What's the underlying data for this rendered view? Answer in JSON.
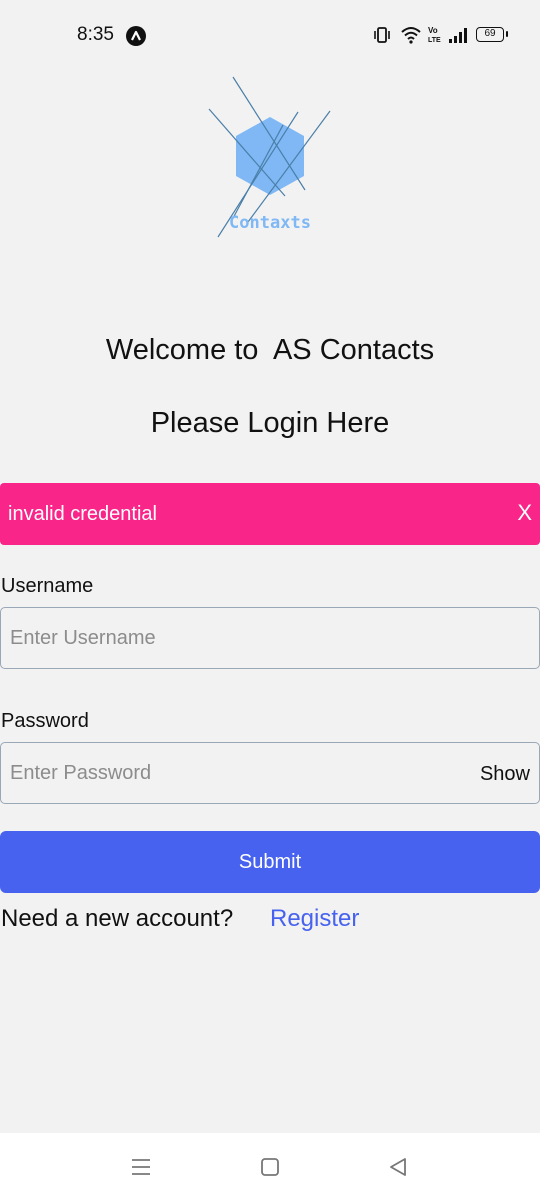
{
  "status_bar": {
    "time": "8:35",
    "battery_level": "69",
    "icons": [
      "app-notification-icon",
      "vibrate-icon",
      "wifi-icon",
      "volte-icon",
      "signal-icon",
      "battery-icon"
    ]
  },
  "logo": {
    "text": "Contaxts",
    "color": "#7fb8f4"
  },
  "welcome_text": "Welcome to  AS Contacts",
  "login_heading": "Please Login Here",
  "alert": {
    "message": "invalid credential",
    "close_label": "X",
    "color": "#f92589"
  },
  "form": {
    "username_label": "Username",
    "username_placeholder": "Enter Username",
    "username_value": "",
    "password_label": "Password",
    "password_placeholder": "Enter Password",
    "password_value": "",
    "show_label": "Show",
    "submit_label": "Submit",
    "submit_color": "#4662ef"
  },
  "register": {
    "prompt": "Need a new account?",
    "link_label": "Register"
  },
  "nav_bar": {
    "icons": [
      "menu-icon",
      "home-icon",
      "back-icon"
    ]
  }
}
